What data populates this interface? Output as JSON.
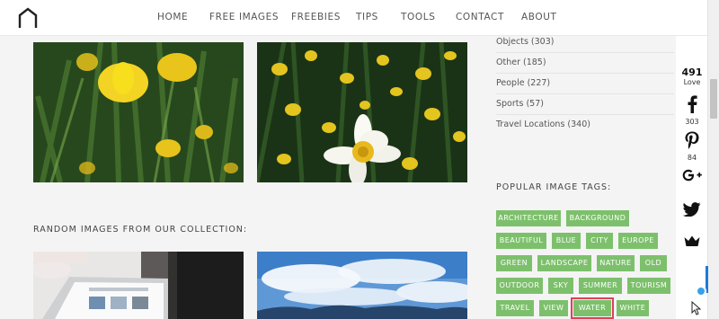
{
  "nav": {
    "items": [
      "HOME",
      "FREE IMAGES",
      "FREEBIES",
      "TIPS",
      "TOOLS",
      "CONTACT",
      "ABOUT"
    ]
  },
  "sections": {
    "random_title": "RANDOM IMAGES FROM OUR COLLECTION:"
  },
  "categories": [
    "Objects (303)",
    "Other (185)",
    "People (227)",
    "Sports (57)",
    "Travel Locations (340)"
  ],
  "tags": {
    "title": "POPULAR IMAGE TAGS:",
    "items": [
      "ARCHITECTURE",
      "BACKGROUND",
      "BEAUTIFUL",
      "BLUE",
      "CITY",
      "EUROPE",
      "GREEN",
      "LANDSCAPE",
      "NATURE",
      "OLD",
      "OUTDOOR",
      "SKY",
      "SUMMER",
      "TOURISM",
      "TRAVEL",
      "VIEW",
      "WATER",
      "WHITE"
    ],
    "highlighted": "WATER"
  },
  "share": {
    "love_count": "491",
    "love_label": "Love",
    "facebook_count": "303",
    "pinterest_count": "84"
  },
  "colors": {
    "tag_green": "#7dc06c",
    "highlight": "#e0405a",
    "accent_blue": "#1f7ad8"
  }
}
